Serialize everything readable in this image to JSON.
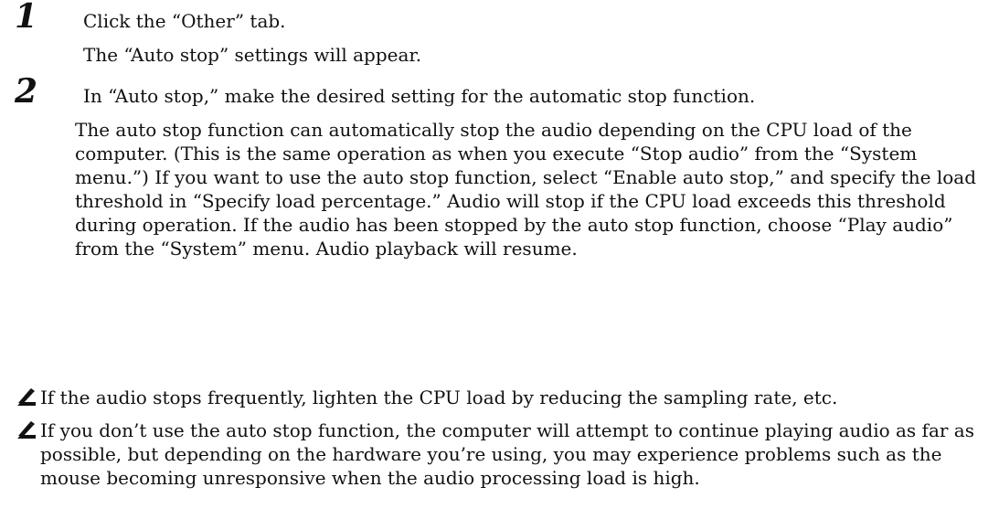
{
  "steps": [
    {
      "number": "1",
      "paragraphs": [
        "Click the “Other” tab.",
        "The “Auto stop” settings will appear."
      ]
    },
    {
      "number": "2",
      "paragraphs": [
        "In “Auto stop,” make the desired setting for the automatic stop function.",
        "The auto stop function can automatically stop the audio depending on the CPU load of the computer. (This is the same operation as when you execute “Stop audio” from the “System menu.”) If you want to use the auto stop function, select “Enable auto stop,” and specify the load threshold in “Specify load percentage.” Audio will stop if the CPU load exceeds this threshold during operation. If the audio has been stopped by the auto stop function, choose “Play audio” from the “System” menu. Audio playback will resume."
      ]
    }
  ],
  "notes": [
    {
      "icon": "pencil-note-icon",
      "text": "If the audio stops frequently, lighten the CPU load by reducing the sampling rate, etc."
    },
    {
      "icon": "pencil-note-icon",
      "text": "If you don’t use the auto stop function, the computer will attempt to continue playing audio as far as possible, but depending on the hardware you’re using, you may experience problems such as the mouse becoming unresponsive when the audio processing load is high."
    }
  ]
}
